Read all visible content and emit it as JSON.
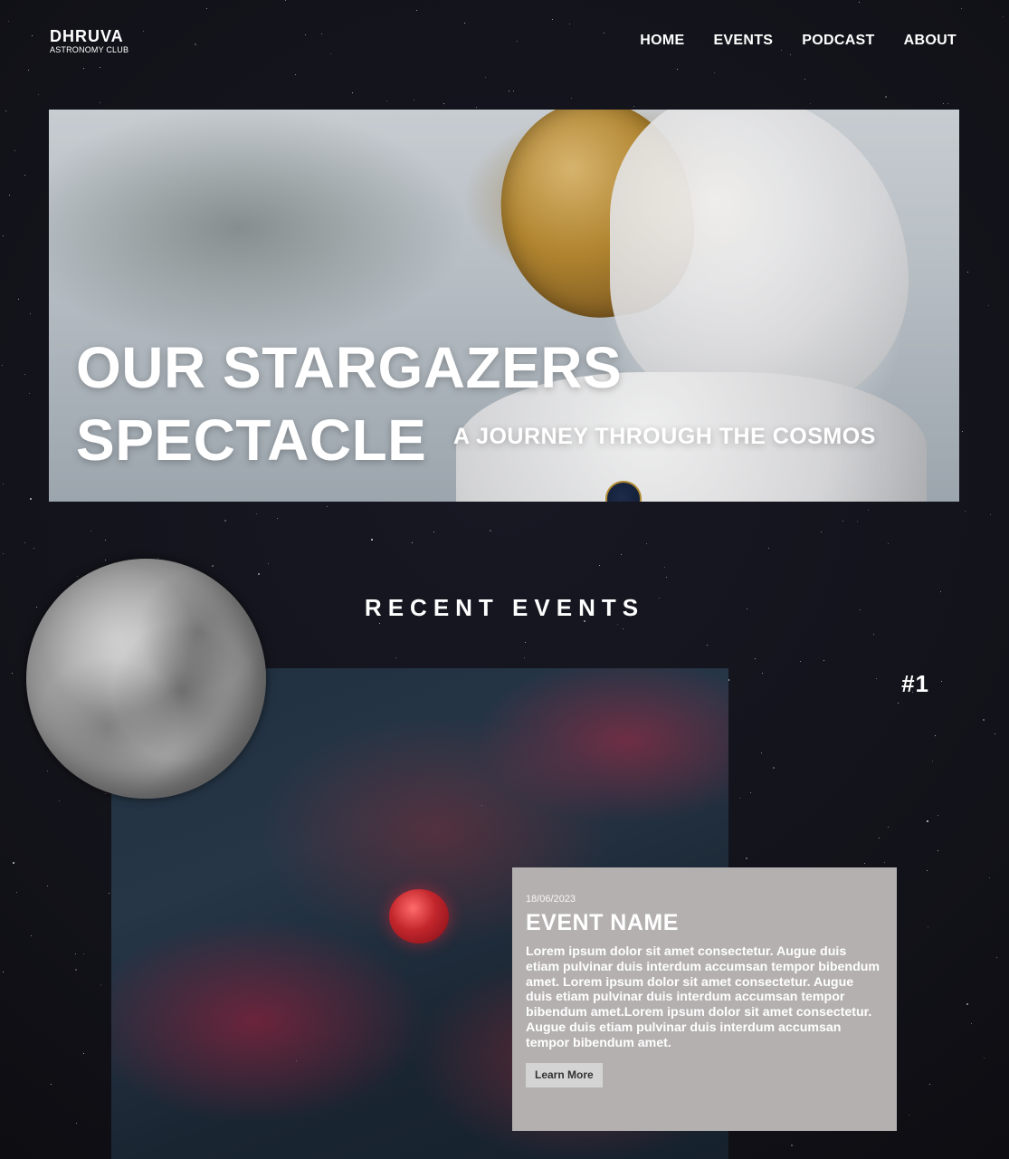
{
  "brand": {
    "name": "DHRUVA",
    "subtitle": "ASTRONOMY CLUB"
  },
  "nav": {
    "items": [
      "HOME",
      "EVENTS",
      "PODCAST",
      "ABOUT"
    ]
  },
  "hero": {
    "title_line1": "OUR STARGAZERS",
    "title_line2": "SPECTACLE",
    "subtitle": "A JOURNEY THROUGH THE COSMOS"
  },
  "recent_events": {
    "title": "RECENT EVENTS",
    "number": "#1",
    "event": {
      "date": "18/06/2023",
      "name": "EVENT NAME",
      "description": "Lorem ipsum dolor sit amet consectetur. Augue duis etiam pulvinar duis interdum accumsan tempor bibendum amet. Lorem ipsum dolor sit amet consectetur. Augue duis etiam pulvinar duis interdum accumsan tempor bibendum amet.Lorem ipsum dolor sit amet consectetur. Augue duis etiam pulvinar duis interdum accumsan tempor bibendum amet.",
      "button_label": "Learn More"
    }
  }
}
